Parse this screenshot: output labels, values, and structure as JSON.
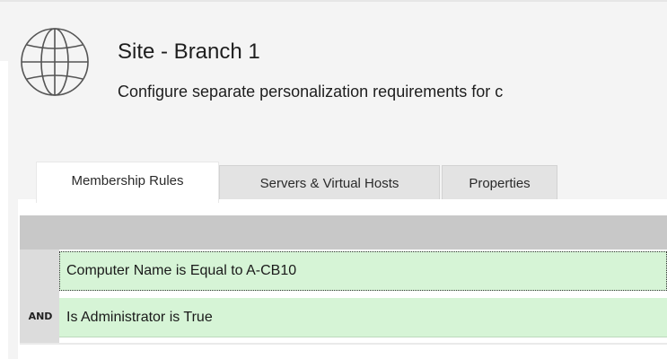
{
  "header": {
    "icon": "globe-icon",
    "title": "Site - Branch 1",
    "subtitle": "Configure separate personalization requirements for c"
  },
  "tabs": [
    {
      "label": "Membership Rules",
      "active": true
    },
    {
      "label": "Servers & Virtual Hosts",
      "active": false
    },
    {
      "label": "Properties",
      "active": false
    }
  ],
  "rules": [
    {
      "operator": "",
      "text": "Computer Name is Equal to A-CB10",
      "selected": true
    },
    {
      "operator": "AND",
      "text": "Is Administrator is True",
      "selected": false
    }
  ],
  "colors": {
    "rule_background": "#d6f4d6",
    "grid_header": "#c8c8c8",
    "window_background": "#f4f4f4"
  }
}
